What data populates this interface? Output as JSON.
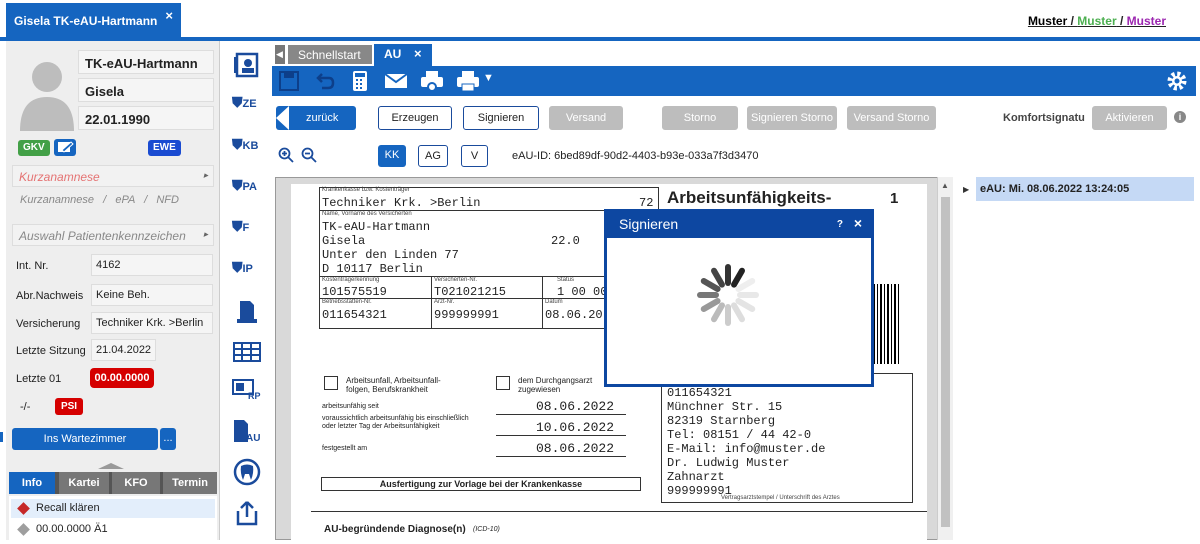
{
  "patient_tab": {
    "title": "Gisela TK-eAU-Hartmann",
    "close": "×"
  },
  "muster_links": {
    "m1": "Muster",
    "sep1": " / ",
    "m2": "Muster",
    "sep2": " / ",
    "m3": "Muster"
  },
  "colors": {
    "primary": "#1565c0",
    "muster2": "#4caf50",
    "muster3": "#9c27b0",
    "red": "#d50000"
  },
  "patient": {
    "lastname": "TK-eAU-Hartmann",
    "firstname": "Gisela",
    "dob": "22.01.1990",
    "badges": {
      "gkv": "GKV",
      "ewe": "EWE",
      "psi": "PSI"
    },
    "kurzanamnese": "Kurzanamnese",
    "sublinks": "Kurzanamnese   /   ePA   /   NFD",
    "auswahl": "Auswahl Patientenkennzeichen",
    "fields": [
      {
        "label": "Int. Nr.",
        "value": "4162"
      },
      {
        "label": "Abr.Nachweis",
        "value": "Keine Beh."
      },
      {
        "label": "Versicherung",
        "value": "Techniker Krk. >Berlin"
      },
      {
        "label": "Letzte Sitzung",
        "value": "21.04.2022"
      },
      {
        "label": "Letzte 01",
        "value": "00.00.0000"
      }
    ],
    "dash": "-/-",
    "wartezimmer": "Ins Wartezimmer",
    "more": "..."
  },
  "bottom_tabs": [
    "Info",
    "Kartei",
    "KFO",
    "Termin"
  ],
  "info_items": [
    {
      "text": "Recall klären"
    },
    {
      "text": "00.00.0000 Ä1"
    }
  ],
  "sidebar_icons": [
    "patient-card-icon",
    "ZE",
    "KB",
    "PA",
    "F",
    "IP",
    "document-icon",
    "table-icon",
    "RP",
    "AU",
    "tooth-icon",
    "export-icon"
  ],
  "sidebar_labels": {
    "ze": "ZE",
    "kb": "KB",
    "pa": "PA",
    "f": "F",
    "ip": "IP",
    "rp": "RP",
    "au": "AU"
  },
  "doc_tabs": {
    "schnellstart": "Schnellstart",
    "au": "AU",
    "close": "×"
  },
  "actions": {
    "zurueck": "zurück",
    "erzeugen": "Erzeugen",
    "signieren": "Signieren",
    "versand": "Versand",
    "storno": "Storno",
    "signieren_storno": "Signieren Storno",
    "versand_storno": "Versand Storno",
    "komfort_label": "Komfortsignatu",
    "aktivieren": "Aktivieren"
  },
  "viewer": {
    "kb": "KK",
    "ag": "AG",
    "v": "V",
    "eau_id": "eAU-ID: 6bed89df-90d2-4403-b93e-033a7f3d3470"
  },
  "form": {
    "kk_label": "Krankenkasse bzw. Kostenträger",
    "kk": "Techniker Krk. >Berlin",
    "kk_num": "72",
    "name_label": "Name, Vorname des Versicherten",
    "name1": "TK-eAU-Hartmann",
    "name2": "Gisela",
    "dob_short": "22.0",
    "street": "Unter den Linden 77",
    "city": "D 10117 Berlin",
    "ktk_label": "Kostenträgerkennung",
    "vnr_label": "Versicherten-Nr.",
    "status_label": "Status",
    "ktk": "101575519",
    "vnr": "T021021215",
    "status": "1 00 00",
    "bsnr_label": "Betriebsstätten-Nr.",
    "lanr_label": "Arzt-Nr.",
    "datum_label": "Datum",
    "bsnr": "011654321",
    "lanr": "999999991",
    "datum": "08.06.20",
    "title": "Arbeitsunfähigkeits-",
    "copy_no": "1",
    "unfall": "Arbeitsunfall, Arbeitsunfall-folgen, Berufskrankheit",
    "durchgang": "dem Durchgangsarzt zugewiesen",
    "au_seit_label": "arbeitsunfähig seit",
    "au_seit": "08.06.2022",
    "au_bis_label": "voraussichtlich arbeitsunfähig bis einschließlich oder letzter Tag der Arbeitsunfähigkeit",
    "au_bis": "10.06.2022",
    "festgestellt_label": "festgestellt am",
    "festgestellt": "08.06.2022",
    "ausfertigung": "Ausfertigung zur Vorlage bei der Krankenkasse",
    "stamp": [
      "011654321",
      "Münchner Str.  15",
      "82319 Starnberg",
      "Tel: 08151 / 44 42-0",
      "E-Mail: info@muster.de",
      "Dr. Ludwig Muster",
      "Zahnarzt",
      "999999991"
    ],
    "stamp_label": "Vertragsarztstempel / Unterschrift des Arztes",
    "diagnose": "AU-begründende Diagnose(n)",
    "icd_label": "(ICD-10)"
  },
  "dialog": {
    "title": "Signieren",
    "help": "?",
    "close": "×"
  },
  "history": {
    "entry": "eAU: Mi. 08.06.2022 13:24:05"
  }
}
